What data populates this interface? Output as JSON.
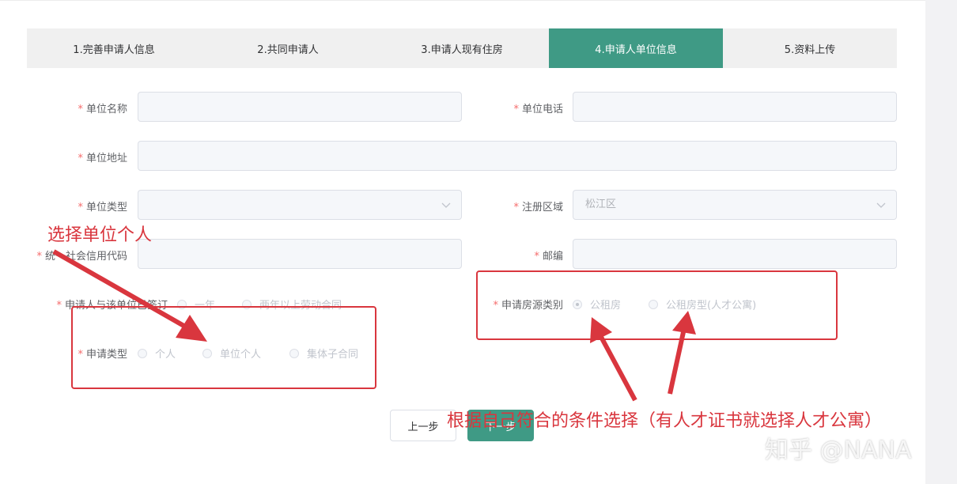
{
  "steps": [
    {
      "label": "1.完善申请人信息",
      "active": false
    },
    {
      "label": "2.共同申请人",
      "active": false
    },
    {
      "label": "3.申请人现有住房",
      "active": false
    },
    {
      "label": "4.申请人单位信息",
      "active": true
    },
    {
      "label": "5.资料上传",
      "active": false
    }
  ],
  "required_mark": "*",
  "form": {
    "unit_name": {
      "label": "单位名称",
      "value": ""
    },
    "unit_phone": {
      "label": "单位电话",
      "value": ""
    },
    "unit_address": {
      "label": "单位地址",
      "value": ""
    },
    "unit_type": {
      "label": "单位类型",
      "value": ""
    },
    "register_area": {
      "label": "注册区域",
      "value": "松江区"
    },
    "credit_code": {
      "label": "统一社会信用代码",
      "value": ""
    },
    "postcode": {
      "label": "邮编",
      "value": ""
    },
    "contract": {
      "label": "申请人与该单位已签订",
      "options": [
        "一年",
        "两年以上劳动合同"
      ],
      "selected": null
    },
    "housing_type": {
      "label": "申请房源类别",
      "options": [
        "公租房",
        "公租房型(人才公寓)"
      ],
      "selected": 0
    },
    "apply_type": {
      "label": "申请类型",
      "options": [
        "个人",
        "单位个人",
        "集体子合同"
      ],
      "selected": null
    }
  },
  "buttons": {
    "prev": "上一步",
    "next": "下一步"
  },
  "annotations": {
    "select_unit_personal": "选择单位个人",
    "choose_by_condition": "根据自己符合的条件选择（有人才证书就选择人才公寓）",
    "accent_color": "#d9363e"
  },
  "watermark": "知乎 @NANA",
  "colors": {
    "primary": "#3f9a85",
    "required": "#f56c6c"
  }
}
